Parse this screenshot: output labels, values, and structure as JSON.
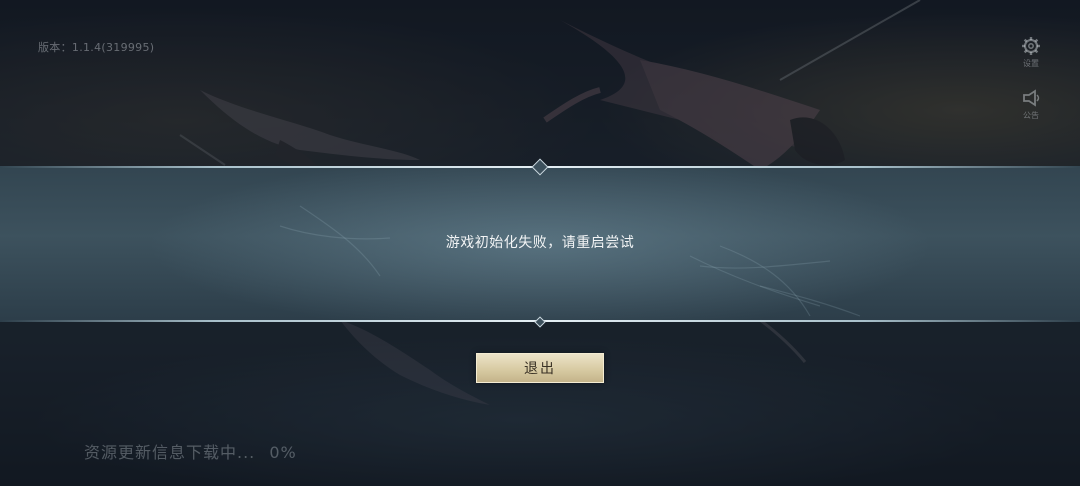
{
  "header": {
    "version_label": "版本：1.1.4(319995)"
  },
  "side_menu": {
    "settings_label": "设置",
    "notice_label": "公告"
  },
  "dialog": {
    "message": "游戏初始化失败，请重启尝试",
    "exit_label": "退出"
  },
  "footer": {
    "progress_text": "资源更新信息下载中...",
    "progress_percent": "0%"
  },
  "colors": {
    "button_gold": "#d8cba3",
    "band_teal": "#40566a",
    "text_white": "#f2f4f5"
  }
}
